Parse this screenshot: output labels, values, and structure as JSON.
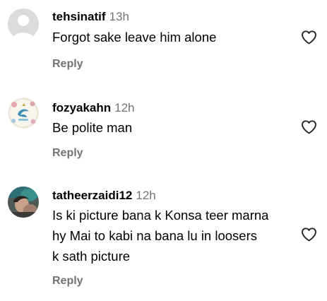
{
  "comments": [
    {
      "username": "tehsinatif",
      "time": "13h",
      "text_lines": [
        "Forgot sake leave him alone"
      ],
      "reply_label": "Reply",
      "avatar": "default-avatar",
      "like_icon": "heart-outline-icon"
    },
    {
      "username": "fozyakahn",
      "time": "12h",
      "text_lines": [
        "Be polite man"
      ],
      "reply_label": "Reply",
      "avatar": "profile-photo",
      "like_icon": "heart-outline-icon"
    },
    {
      "username": "tatheerzaidi12",
      "time": "12h",
      "text_lines": [
        "Is ki picture bana k Konsa teer marna",
        "hy Mai to kabi na bana lu in loosers",
        "k sath picture"
      ],
      "reply_label": "Reply",
      "avatar": "profile-photo",
      "like_icon": "heart-outline-icon"
    }
  ],
  "colors": {
    "username": "#000000",
    "meta_gray": "#737373",
    "icon_stroke": "#262626",
    "default_avatar_bg": "#dbdbdb"
  }
}
